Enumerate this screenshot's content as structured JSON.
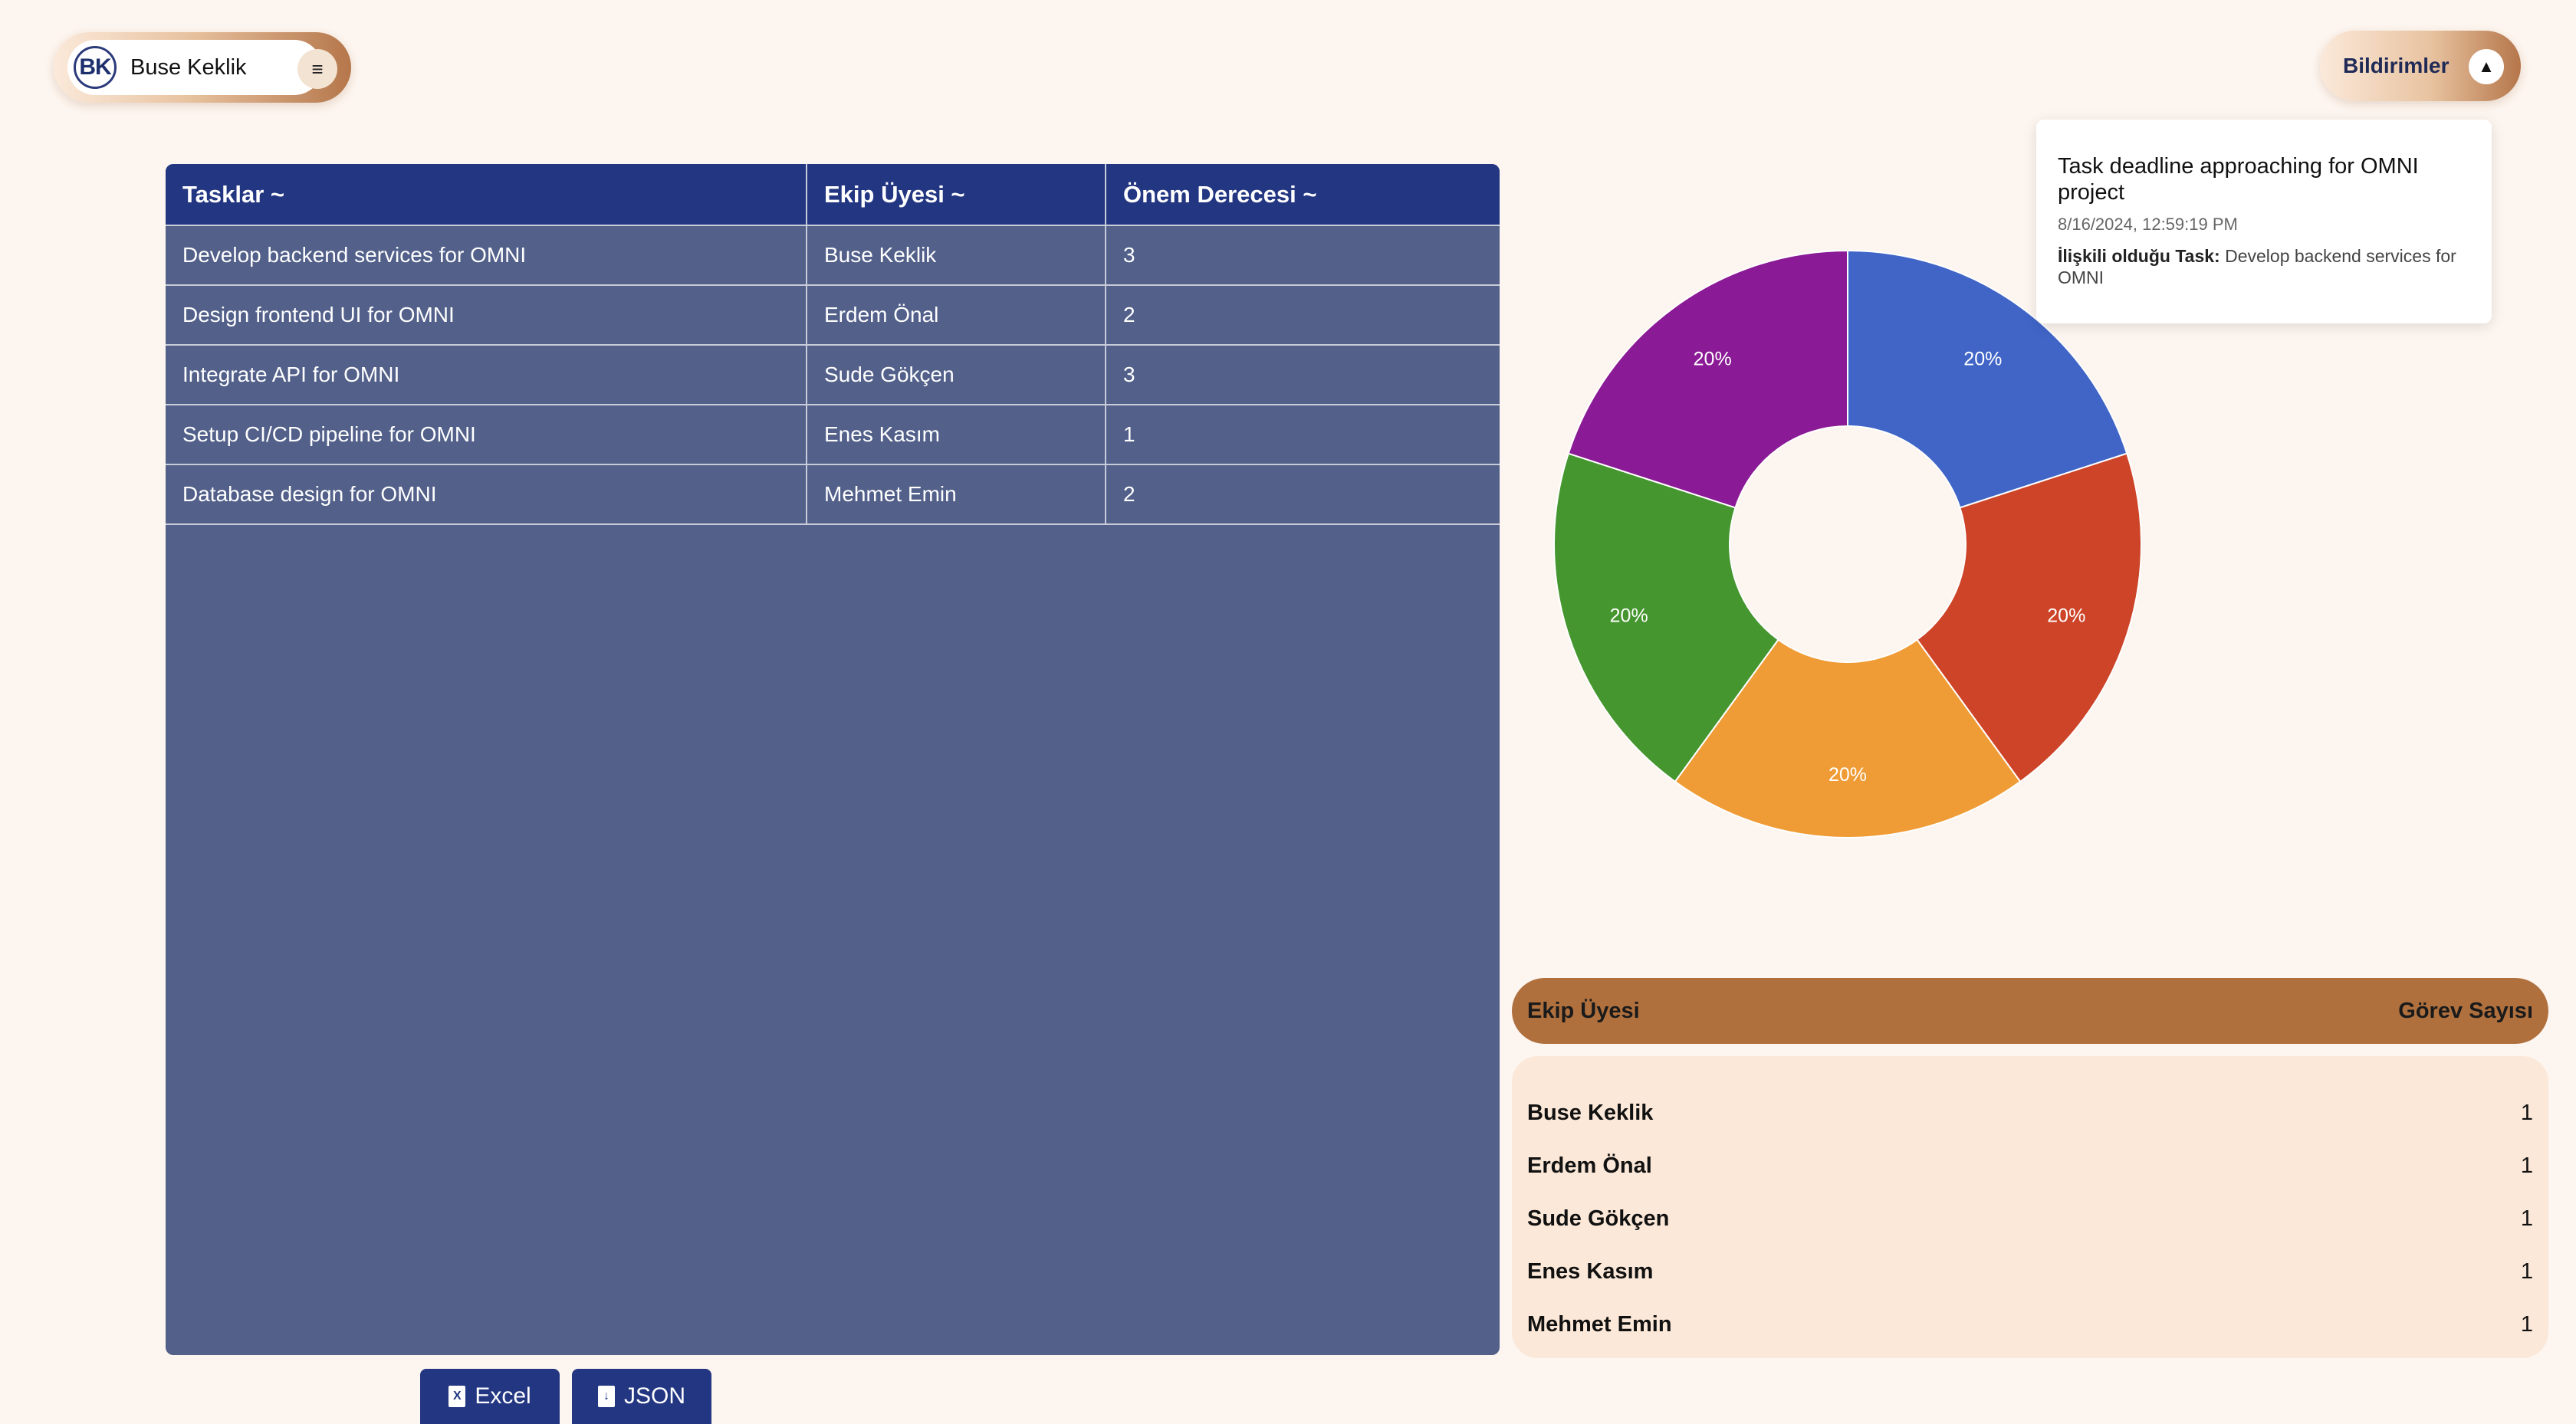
{
  "user": {
    "initials": "BK",
    "name": "Buse Keklik",
    "menu_icon": "≡"
  },
  "notifications": {
    "label": "Bildirimler",
    "toggle_icon": "▲",
    "items": [
      {
        "message": "Task deadline approaching for OMNI project",
        "date": "8/16/2024, 12:59:19 PM",
        "related_label": "İlişkili olduğu Task:",
        "related_task": "Develop backend services for OMNI"
      }
    ]
  },
  "table": {
    "headers": [
      "Tasklar ~",
      "Ekip Üyesi ~",
      "Önem Derecesi ~"
    ],
    "rows": [
      [
        "Develop backend services for OMNI",
        "Buse Keklik",
        "3"
      ],
      [
        "Design frontend UI for OMNI",
        "Erdem Önal",
        "2"
      ],
      [
        "Integrate API for OMNI",
        "Sude Gökçen",
        "3"
      ],
      [
        "Setup CI/CD pipeline for OMNI",
        "Enes Kasım",
        "1"
      ],
      [
        "Database design for OMNI",
        "Mehmet Emin",
        "2"
      ]
    ]
  },
  "export": {
    "excel_label": "Excel",
    "json_label": "JSON"
  },
  "chart_data": {
    "type": "pie",
    "donut": true,
    "slices": [
      {
        "label": "Buse Keklik",
        "value": 1,
        "percent_label": "20%",
        "color": "#4065c7"
      },
      {
        "label": "Erdem Önal",
        "value": 1,
        "percent_label": "20%",
        "color": "#cd4428"
      },
      {
        "label": "Sude Gökçen",
        "value": 1,
        "percent_label": "20%",
        "color": "#f09c36"
      },
      {
        "label": "Enes Kasım",
        "value": 1,
        "percent_label": "20%",
        "color": "#469630"
      },
      {
        "label": "Mehmet Emin",
        "value": 1,
        "percent_label": "20%",
        "color": "#8a1a95"
      }
    ]
  },
  "summary": {
    "header_member": "Ekip Üyesi",
    "header_count": "Görev Sayısı",
    "rows": [
      {
        "member": "Buse Keklik",
        "count": "1"
      },
      {
        "member": "Erdem Önal",
        "count": "1"
      },
      {
        "member": "Sude Gökçen",
        "count": "1"
      },
      {
        "member": "Enes Kasım",
        "count": "1"
      },
      {
        "member": "Mehmet Emin",
        "count": "1"
      }
    ]
  }
}
